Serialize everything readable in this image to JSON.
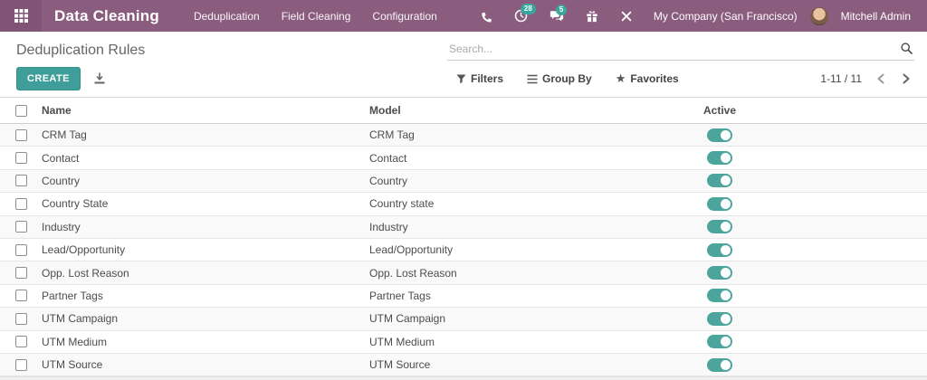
{
  "navbar": {
    "app_name": "Data Cleaning",
    "menu_items": [
      {
        "id": "deduplication",
        "label": "Deduplication"
      },
      {
        "id": "field-cleaning",
        "label": "Field Cleaning"
      },
      {
        "id": "configuration",
        "label": "Configuration"
      }
    ],
    "activity_badge": "28",
    "message_badge": "5",
    "company": "My Company (San Francisco)",
    "user": "Mitchell Admin",
    "icons": [
      "apps-grid-icon",
      "phone-icon",
      "clock-activity-icon",
      "chat-messages-icon",
      "gift-icon",
      "tools-icon"
    ]
  },
  "control_panel": {
    "title": "Deduplication Rules",
    "create_label": "CREATE",
    "search_placeholder": "Search...",
    "filters_label": "Filters",
    "group_by_label": "Group By",
    "favorites_label": "Favorites",
    "favorites_star": "★",
    "pager_text": "1-11 / 11"
  },
  "table": {
    "columns": {
      "name": "Name",
      "model": "Model",
      "active": "Active"
    },
    "rows": [
      {
        "name": "CRM Tag",
        "model": "CRM Tag",
        "active": true
      },
      {
        "name": "Contact",
        "model": "Contact",
        "active": true
      },
      {
        "name": "Country",
        "model": "Country",
        "active": true
      },
      {
        "name": "Country State",
        "model": "Country state",
        "active": true
      },
      {
        "name": "Industry",
        "model": "Industry",
        "active": true
      },
      {
        "name": "Lead/Opportunity",
        "model": "Lead/Opportunity",
        "active": true
      },
      {
        "name": "Opp. Lost Reason",
        "model": "Opp. Lost Reason",
        "active": true
      },
      {
        "name": "Partner Tags",
        "model": "Partner Tags",
        "active": true
      },
      {
        "name": "UTM Campaign",
        "model": "UTM Campaign",
        "active": true
      },
      {
        "name": "UTM Medium",
        "model": "UTM Medium",
        "active": true
      },
      {
        "name": "UTM Source",
        "model": "UTM Source",
        "active": true
      }
    ]
  },
  "colors": {
    "navbar_bg": "#8a5c7e",
    "primary_teal": "#3f9e99",
    "toggle_teal": "#4ba59d",
    "badge_teal": "#38a79c",
    "row_stripe": "#f9f9f9"
  }
}
